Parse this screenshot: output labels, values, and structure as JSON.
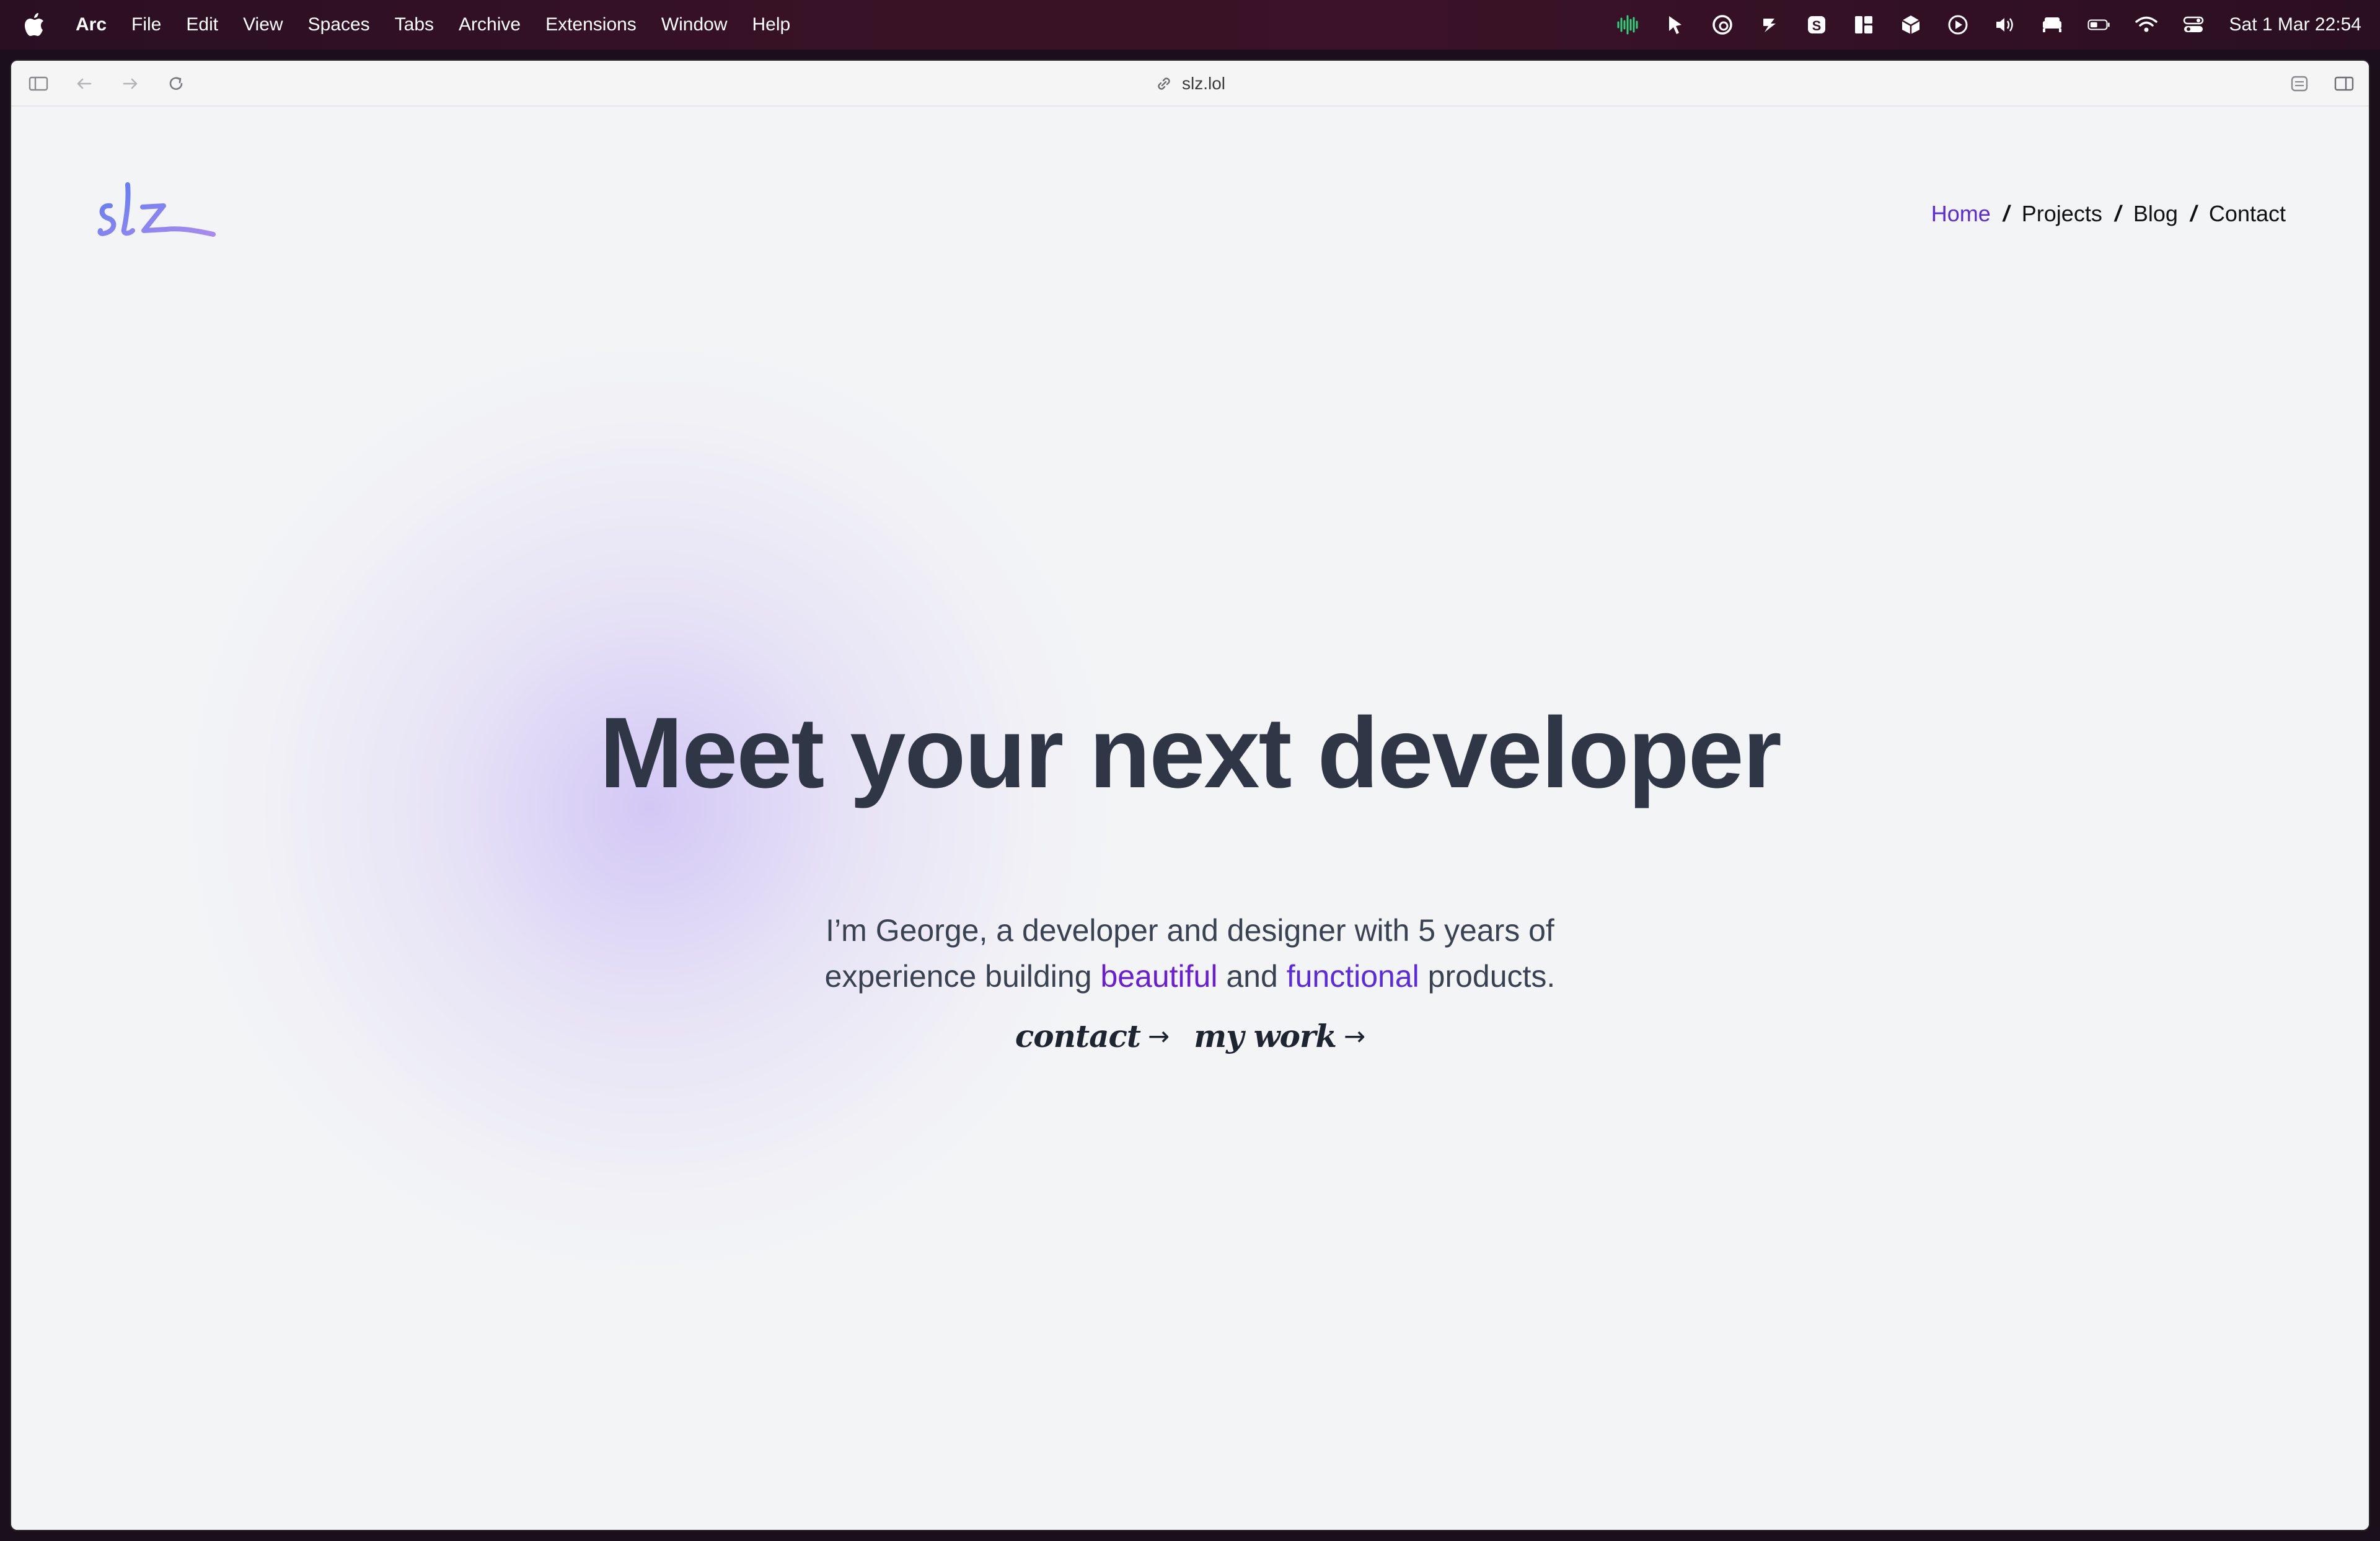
{
  "menubar": {
    "app_name": "Arc",
    "items": [
      "File",
      "Edit",
      "View",
      "Spaces",
      "Tabs",
      "Archive",
      "Extensions",
      "Window",
      "Help"
    ],
    "clock": "Sat 1 Mar  22:54"
  },
  "browser": {
    "url": "slz.lol"
  },
  "site": {
    "logo_text": "slz",
    "nav": {
      "home": "Home",
      "projects": "Projects",
      "blog": "Blog",
      "contact": "Contact",
      "separator": "/"
    },
    "hero": {
      "title": "Meet your next developer",
      "sub_line1": "I’m George, a developer and designer with 5 years of",
      "sub_line2_start": "experience building ",
      "accent_beautiful": "beautiful",
      "sub_and": " and ",
      "accent_functional": "functional",
      "sub_end": " products."
    },
    "cta": {
      "contact": "contact",
      "work": "my work",
      "arrow": "→"
    }
  },
  "colors": {
    "accent": "#6a1dd6",
    "nav_active": "#5b2bd9",
    "title": "#2f3747",
    "page_bg": "#f3f4f6"
  }
}
